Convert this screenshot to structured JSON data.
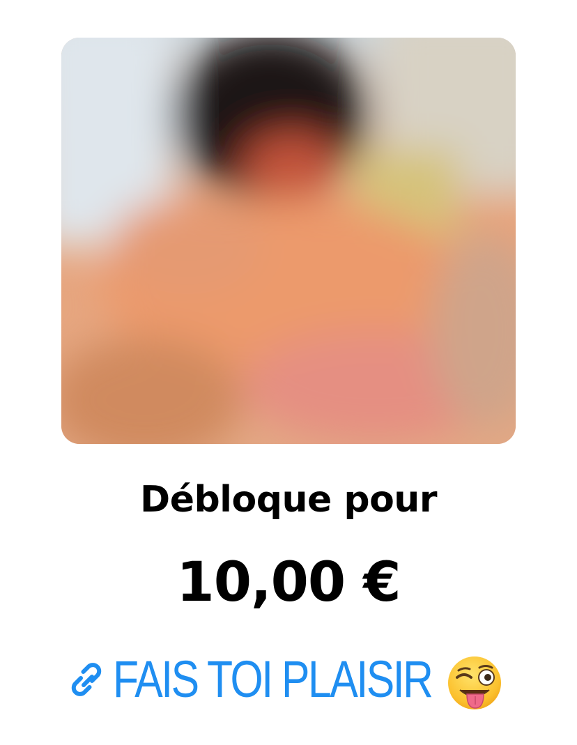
{
  "unlock": {
    "label": "Débloque pour",
    "price": "10,00 €"
  },
  "cta": {
    "label": "FAIS TOI PLAISIR",
    "link_icon": "link-icon",
    "emoji_icon": "winking-face-with-tongue-icon",
    "color": "#1f8ef1"
  },
  "media": {
    "state": "blurred-locked-preview"
  }
}
